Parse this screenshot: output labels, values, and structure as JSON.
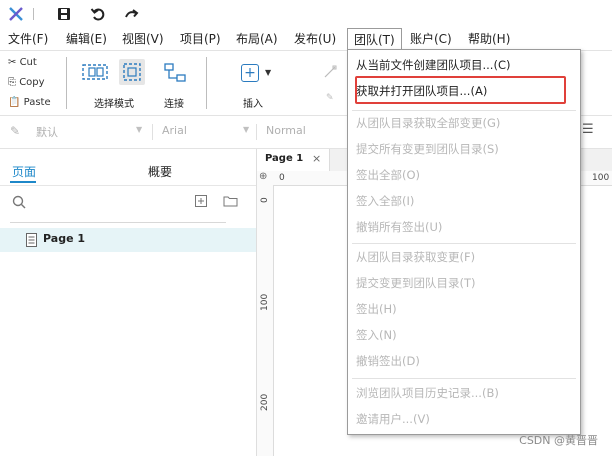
{
  "app": {
    "menu": [
      "文件(F)",
      "编辑(E)",
      "视图(V)",
      "项目(P)",
      "布局(A)",
      "发布(U)",
      "团队(T)",
      "账户(C)",
      "帮助(H)"
    ]
  },
  "toolbar": {
    "cut": "Cut",
    "copy": "Copy",
    "paste": "Paste",
    "select_mode": "选择模式",
    "connect": "连接",
    "insert": "插入"
  },
  "formatbar": {
    "style": "默认",
    "font": "Arial",
    "weight": "Normal"
  },
  "left_panel": {
    "tab_pages": "页面",
    "tab_outline": "概要",
    "page_item": "Page 1"
  },
  "canvas": {
    "tab_label": "Page 1",
    "tab_close": "×",
    "ruler_top": [
      "0",
      "100"
    ],
    "ruler_left": [
      "0",
      "100",
      "200"
    ]
  },
  "team_menu": {
    "items": [
      {
        "label": "从当前文件创建团队项目...(C)",
        "enabled": true
      },
      {
        "label": "获取并打开团队项目...(A)",
        "enabled": true
      },
      {
        "label": "从团队目录获取全部变更(G)",
        "enabled": false
      },
      {
        "label": "提交所有变更到团队目录(S)",
        "enabled": false
      },
      {
        "label": "签出全部(O)",
        "enabled": false
      },
      {
        "label": "签入全部(I)",
        "enabled": false
      },
      {
        "label": "撤销所有签出(U)",
        "enabled": false
      },
      {
        "label": "从团队目录获取变更(F)",
        "enabled": false
      },
      {
        "label": "提交变更到团队目录(T)",
        "enabled": false
      },
      {
        "label": "签出(H)",
        "enabled": false
      },
      {
        "label": "签入(N)",
        "enabled": false
      },
      {
        "label": "撤销签出(D)",
        "enabled": false
      },
      {
        "label": "浏览团队项目历史记录...(B)",
        "enabled": false
      },
      {
        "label": "邀请用户...(V)",
        "enabled": false
      }
    ]
  },
  "watermark": "CSDN @黄晋晋",
  "colors": {
    "accent_blue": "#1e88c9",
    "highlight_red": "#e0403a",
    "selected_row": "#e6f4f7"
  }
}
